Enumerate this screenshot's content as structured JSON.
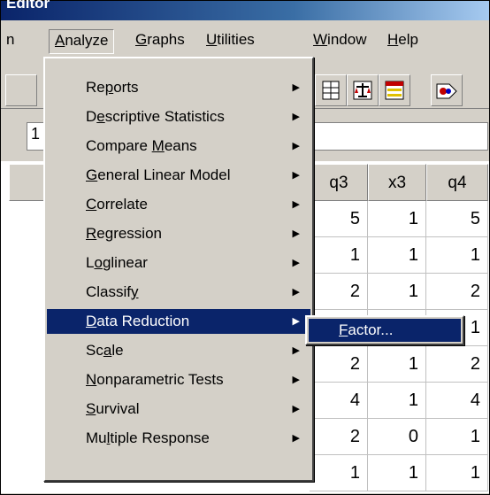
{
  "window": {
    "title": "Editor"
  },
  "menubar": {
    "items": [
      {
        "label_pre": "",
        "accel": "",
        "label_post": "n"
      },
      {
        "label_pre": "",
        "accel": "A",
        "label_post": "nalyze"
      },
      {
        "label_pre": "",
        "accel": "G",
        "label_post": "raphs"
      },
      {
        "label_pre": "",
        "accel": "U",
        "label_post": "tilities"
      },
      {
        "label_pre": "",
        "accel": "W",
        "label_post": "indow"
      },
      {
        "label_pre": "",
        "accel": "H",
        "label_post": "elp"
      }
    ]
  },
  "editline": {
    "value": "1"
  },
  "grid": {
    "headers": [
      "q3",
      "x3",
      "q4"
    ],
    "rows": [
      [
        "5",
        "1",
        "5"
      ],
      [
        "1",
        "1",
        "1"
      ],
      [
        "2",
        "1",
        "2"
      ],
      [
        "",
        "",
        "1"
      ],
      [
        "2",
        "1",
        "2"
      ],
      [
        "4",
        "1",
        "4"
      ],
      [
        "2",
        "0",
        "1"
      ],
      [
        "1",
        "1",
        "1"
      ]
    ]
  },
  "analyze_menu": {
    "items": [
      {
        "pre": "Re",
        "accel": "p",
        "post": "orts"
      },
      {
        "pre": "D",
        "accel": "e",
        "post": "scriptive Statistics"
      },
      {
        "pre": "Compare ",
        "accel": "M",
        "post": "eans"
      },
      {
        "pre": "",
        "accel": "G",
        "post": "eneral Linear Model"
      },
      {
        "pre": "",
        "accel": "C",
        "post": "orrelate"
      },
      {
        "pre": "",
        "accel": "R",
        "post": "egression"
      },
      {
        "pre": "L",
        "accel": "o",
        "post": "glinear"
      },
      {
        "pre": "Classif",
        "accel": "y",
        "post": ""
      },
      {
        "pre": "",
        "accel": "D",
        "post": "ata Reduction"
      },
      {
        "pre": "Sc",
        "accel": "a",
        "post": "le"
      },
      {
        "pre": "",
        "accel": "N",
        "post": "onparametric Tests"
      },
      {
        "pre": "",
        "accel": "S",
        "post": "urvival"
      },
      {
        "pre": "Mu",
        "accel": "l",
        "post": "tiple Response"
      }
    ],
    "arrow": "▶"
  },
  "submenu": {
    "pre": "",
    "accel": "F",
    "post": "actor..."
  }
}
